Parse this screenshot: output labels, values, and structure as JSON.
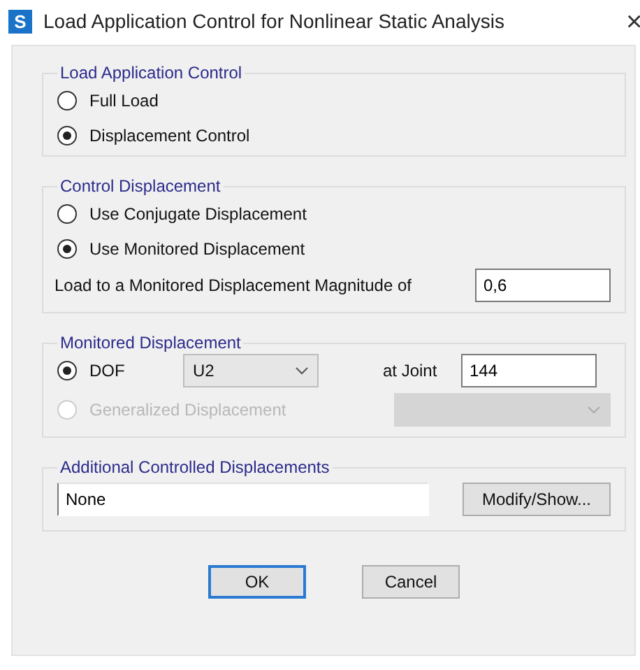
{
  "window": {
    "app_icon": "S",
    "title": "Load Application Control for Nonlinear Static Analysis",
    "close": "×"
  },
  "load_application_control": {
    "legend": "Load Application Control",
    "options": [
      {
        "label": "Full Load",
        "selected": false,
        "disabled": false
      },
      {
        "label": "Displacement Control",
        "selected": true,
        "disabled": false
      }
    ]
  },
  "control_displacement": {
    "legend": "Control Displacement",
    "options": [
      {
        "label": "Use Conjugate Displacement",
        "selected": false,
        "disabled": false
      },
      {
        "label": "Use Monitored Displacement",
        "selected": true,
        "disabled": false
      }
    ],
    "magnitude_label": "Load to a Monitored Displacement Magnitude of",
    "magnitude_value": "0,6"
  },
  "monitored_displacement": {
    "legend": "Monitored Displacement",
    "dof": {
      "label": "DOF",
      "selected": true,
      "disabled": false,
      "value": "U2"
    },
    "joint_label": "at Joint",
    "joint_value": "144",
    "generalized": {
      "label": "Generalized Displacement",
      "selected": false,
      "disabled": true
    }
  },
  "additional_controlled_displacements": {
    "legend": "Additional Controlled Displacements",
    "value": "None",
    "button": "Modify/Show..."
  },
  "buttons": [
    {
      "label": "OK",
      "default": true
    },
    {
      "label": "Cancel",
      "default": false
    }
  ]
}
